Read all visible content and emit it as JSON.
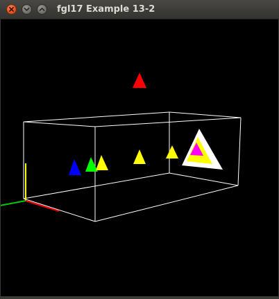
{
  "window": {
    "title": "fgl17 Example 13-2"
  },
  "icons": {
    "close": "close-icon",
    "minimize": "minimize-icon",
    "maximize": "maximize-icon"
  },
  "scene": {
    "background": "#000000",
    "box_color": "#ffffff",
    "axis_colors": {
      "x": "#ff0000",
      "y": "#ffff00",
      "z": "#00ff00"
    },
    "marker_colors": [
      "#ff0000",
      "#0000ff",
      "#00ff00",
      "#ffff00",
      "#ffff00",
      "#ffff00",
      "#ffffff",
      "#ffff00",
      "#ff00ff"
    ]
  }
}
